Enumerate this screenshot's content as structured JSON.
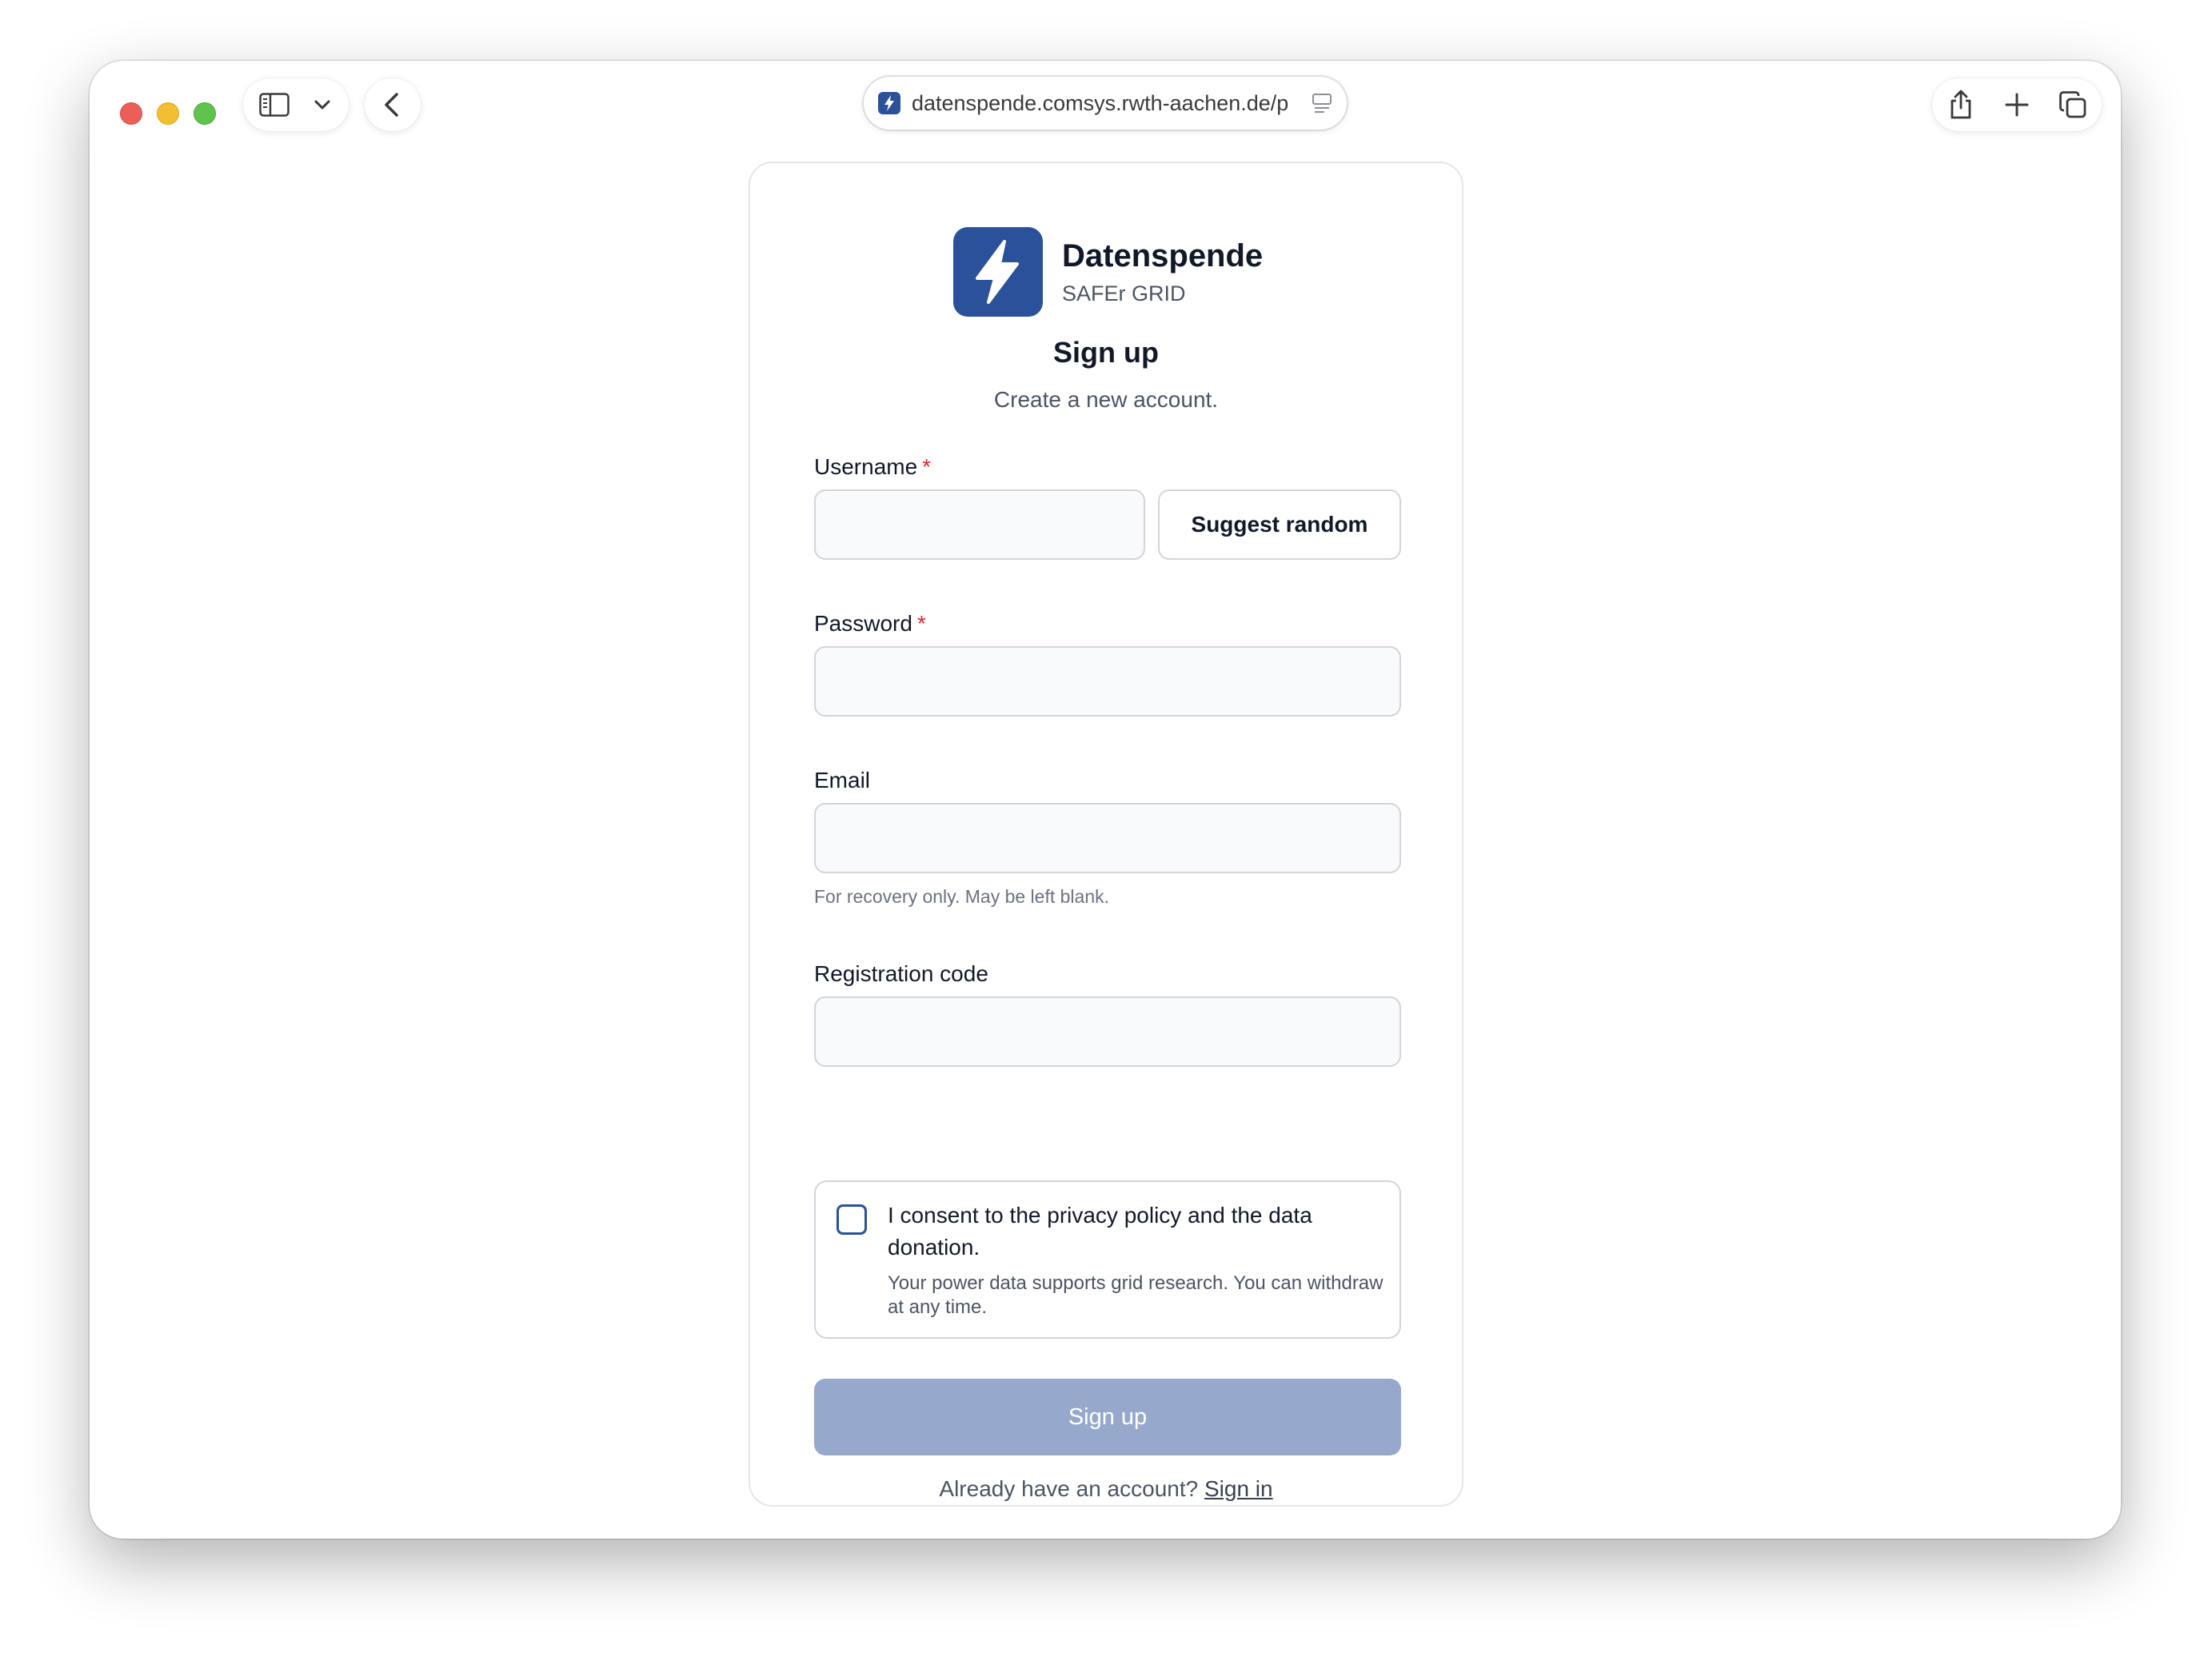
{
  "browser": {
    "url": "datenspende.comsys.rwth-aachen.de/p"
  },
  "brand": {
    "name": "Datenspende",
    "subtitle": "SAFEr GRID"
  },
  "form": {
    "title": "Sign up",
    "subtitle": "Create a new account.",
    "username": {
      "label": "Username",
      "required_mark": "*",
      "value": ""
    },
    "suggest_button": "Suggest random",
    "password": {
      "label": "Password",
      "required_mark": "*",
      "value": ""
    },
    "email": {
      "label": "Email",
      "value": "",
      "hint": "For recovery only. May be left blank."
    },
    "registration_code": {
      "label": "Registration code",
      "value": ""
    },
    "consent": {
      "checked": false,
      "label": "I consent to the privacy policy and the data donation.",
      "description": "Your power data supports grid research. You can withdraw at any time."
    },
    "submit_button": "Sign up",
    "footer": {
      "prompt": "Already have an account?",
      "link": "Sign in"
    }
  },
  "colors": {
    "brand": "#2b519a",
    "submit_disabled": "#96a9cc",
    "required": "#dc2626"
  }
}
